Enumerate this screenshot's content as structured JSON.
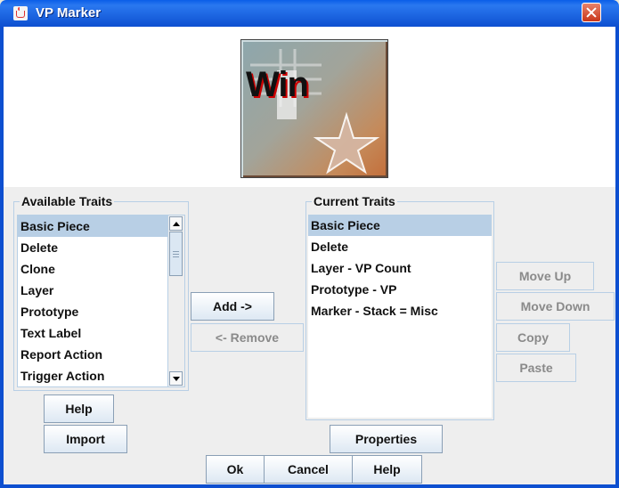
{
  "window": {
    "title": "VP Marker",
    "app_icon": "java-cup-icon",
    "close_icon": "close-icon"
  },
  "preview": {
    "piece_text": "Win",
    "decoration_icon": "star-icon"
  },
  "available_traits": {
    "title": "Available Traits",
    "items": [
      "Basic Piece",
      "Delete",
      "Clone",
      "Layer",
      "Prototype",
      "Text Label",
      "Report Action",
      "Trigger Action"
    ],
    "selected": "Basic Piece"
  },
  "current_traits": {
    "title": "Current Traits",
    "items": [
      "Basic Piece",
      "Delete",
      "Layer - VP Count",
      "Prototype - VP",
      "Marker - Stack = Misc"
    ],
    "selected": "Basic Piece"
  },
  "buttons": {
    "add": "Add ->",
    "remove": "<- Remove",
    "move_up": "Move Up",
    "move_down": "Move Down",
    "copy": "Copy",
    "paste": "Paste",
    "help_left": "Help",
    "import": "Import",
    "properties": "Properties",
    "ok": "Ok",
    "cancel": "Cancel",
    "help": "Help"
  },
  "colors": {
    "selection": "#b8cfe5",
    "title_bar": "#0a5ee8",
    "close": "#c8361a"
  }
}
